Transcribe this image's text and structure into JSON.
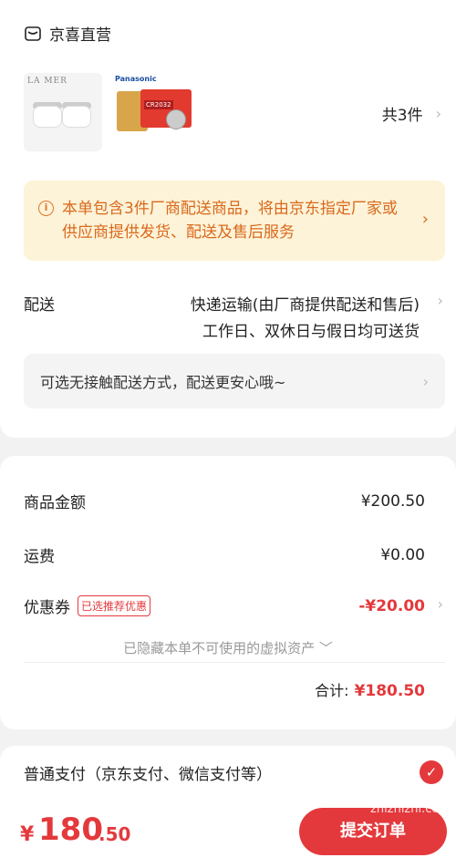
{
  "store": {
    "name": "京喜直营",
    "icon": "store-icon"
  },
  "products": {
    "thumb1_brand": "LA MER",
    "thumb2_brand": "Panasonic",
    "thumb2_model": "CR2032",
    "quantity_label": "共3件"
  },
  "notice": {
    "text": "本单包含3件厂商配送商品，将由京东指定厂家或供应商提供发货、配送及售后服务",
    "icon": "info-icon"
  },
  "delivery": {
    "label": "配送",
    "method": "快递运输(由厂商提供配送和售后)",
    "schedule": "工作日、双休日与假日均可送货",
    "contactless": "可选无接触配送方式，配送更安心哦~"
  },
  "summary": {
    "goods_label": "商品金额",
    "goods_value": "¥200.50",
    "shipping_label": "运费",
    "shipping_value": "¥0.00",
    "coupon_label": "优惠券",
    "coupon_badge": "已选推荐优惠",
    "coupon_value": "-¥20.00",
    "hidden_assets": "已隐藏本单不可使用的虚拟资产 ﹀",
    "total_label": "合计:",
    "total_value": "¥180.50"
  },
  "payment": {
    "method": "普通支付（京东支付、微信支付等）",
    "selected": true
  },
  "bottom": {
    "price_yen": "¥",
    "price_int": "180",
    "price_dec": ".50",
    "submit_label": "提交订单",
    "watermark": "zhizhizhi.com"
  },
  "colors": {
    "accent": "#e4393c",
    "notice_bg": "#fdf3d8",
    "notice_text": "#d9691c"
  }
}
